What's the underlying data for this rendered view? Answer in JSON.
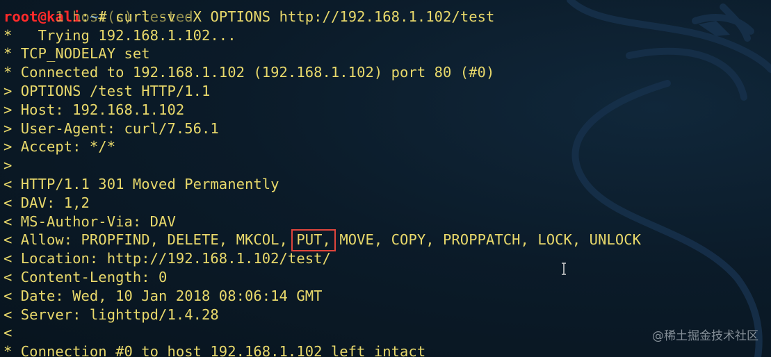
{
  "terminal": {
    "partial_top_line": "1 host(s) tested",
    "prompt": {
      "user_host": "root@kali",
      "separator": ":",
      "path": "~",
      "symbol": "# ",
      "command": "curl -v -X OPTIONS http://192.168.1.102/test"
    },
    "lines": [
      "*   Trying 192.168.1.102...",
      "* TCP_NODELAY set",
      "* Connected to 192.168.1.102 (192.168.1.102) port 80 (#0)",
      "> OPTIONS /test HTTP/1.1",
      "> Host: 192.168.1.102",
      "> User-Agent: curl/7.56.1",
      "> Accept: */*",
      ">",
      "< HTTP/1.1 301 Moved Permanently",
      "< DAV: 1,2",
      "< MS-Author-Via: DAV"
    ],
    "allow_line": {
      "before": "< Allow: PROPFIND, DELETE, MKCOL, ",
      "highlight": "PUT,",
      "after": " MOVE, COPY, PROPPATCH, LOCK, UNLOCK"
    },
    "lines_after": [
      "< Location: http://192.168.1.102/test/",
      "< Content-Length: 0",
      "< Date: Wed, 10 Jan 2018 08:06:14 GMT",
      "< Server: lighttpd/1.4.28",
      "<",
      "* Connection #0 to host 192.168.1.102 left intact"
    ]
  },
  "watermark": "@稀土掘金技术社区",
  "colors": {
    "background": "#0b1a27",
    "text": "#e9d96b",
    "prompt_user": "#ff2a2a",
    "prompt_path": "#5fa8ff",
    "highlight_box": "#e0453c"
  },
  "icons": {
    "background_logo": "kali-dragon-icon",
    "mouse_cursor": "i-beam-cursor-icon"
  }
}
